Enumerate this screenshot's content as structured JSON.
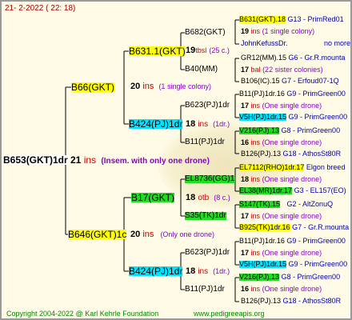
{
  "header": {
    "date": "21-  2-2022 ( 22: 18)"
  },
  "footer": {
    "copyright": "Copyright 2004-2022 @ Karl Kehrle Foundation",
    "site": "www.pedigreeapis.org"
  },
  "root": {
    "label": "B653(GKT)1dr",
    "num": "21",
    "ins": "ins",
    "note": "(Insem. with only one drone)"
  },
  "gen1": [
    {
      "label": "B66(GKT)",
      "num": "20",
      "ins": "ins",
      "note": "(1 single colony)"
    },
    {
      "label": "B646(GKT)1c",
      "num": "20",
      "ins": "ins",
      "note": "(Only one drone)"
    }
  ],
  "gen2": [
    {
      "label": "B631.1(GKT)",
      "num": "19",
      "ins": "tbsl",
      "note": "(25 c.)"
    },
    {
      "label": "B424(PJ)1dr",
      "num": "18",
      "ins": "ins",
      "note": "(1dr.)"
    },
    {
      "label": "B17(GKT)",
      "num": "18",
      "ins": "otb",
      "note": "(8 c.)"
    },
    {
      "label": "B424(PJ)1dr",
      "num": "18",
      "ins": "ins",
      "note": "(1dr.)"
    }
  ],
  "gen3": [
    {
      "label": "B682(GKT)"
    },
    {
      "label": "B40(MM)"
    },
    {
      "label": "B623(PJ)1dr"
    },
    {
      "label": "B11(PJ)1dr"
    },
    {
      "label": "EL8736(GG)1"
    },
    {
      "label": "S35(TK)1dr"
    },
    {
      "label": "B623(PJ)1dr"
    },
    {
      "label": "B11(PJ)1dr"
    }
  ],
  "gen4": [
    {
      "label": "B631(GKT).18",
      "suffix": "G13 - PrimRed01"
    },
    {
      "num": "19",
      "ins": "ins",
      "note": "(1 single colony)"
    },
    {
      "label": "JohnKefussDr.",
      "suffix": "no more"
    },
    {
      "label": "GR12(MM).15",
      "suffix": "G6 - Gr.R.mounta"
    },
    {
      "num": "17",
      "ins": "bal",
      "note": "(22 sister colonies)"
    },
    {
      "label": "B106(IC).15",
      "suffix": "G7 - Erfoud07-1Q"
    },
    {
      "label": "B11(PJ)1dr.16",
      "suffix": "G9 - PrimGreen00"
    },
    {
      "num": "17",
      "ins": "ins",
      "note": "(One single drone)"
    },
    {
      "label": "V5H(PJ)1dr.15",
      "suffix": "G9 - PrimGreen00"
    },
    {
      "label": "V216(PJ).13",
      "suffix": "G8 - PrimGreen00"
    },
    {
      "num": "16",
      "ins": "ins",
      "note": "(One single drone)"
    },
    {
      "label": "B126(PJ).13",
      "suffix": "G18 - AthosSt80R"
    },
    {
      "label": "EL7112(RHO)1dr.17",
      "suffix": "Elgon breed"
    },
    {
      "num": "18",
      "ins": "ins",
      "note": "(One single drone)"
    },
    {
      "label": "EL38(MR)1dr.17",
      "suffix": "G3 - EL157(EO)"
    },
    {
      "label": "S147(TK).15",
      "suffix": "G2 - AltZonuQ"
    },
    {
      "num": "17",
      "ins": "ins",
      "note": "(One single drone)"
    },
    {
      "label": "B925(TK)1dr.16",
      "suffix": "G7 - Gr.R.mounta"
    },
    {
      "label": "B11(PJ)1dr.16",
      "suffix": "G9 - PrimGreen00"
    },
    {
      "num": "17",
      "ins": "ins",
      "note": "(One single drone)"
    },
    {
      "label": "V5H(PJ)1dr.15",
      "suffix": "G9 - PrimGreen00"
    },
    {
      "label": "V216(PJ).13",
      "suffix": "G8 - PrimGreen00"
    },
    {
      "num": "16",
      "ins": "ins",
      "note": "(One single drone)"
    },
    {
      "label": "B126(PJ).13",
      "suffix": "G18 - AthosSt80R"
    }
  ],
  "colors": {
    "highlight_yellow": "#ffff00",
    "highlight_cyan": "#00e5ff",
    "highlight_green": "#22dd22",
    "ins_red": "#cc0000",
    "note_purple": "#8800cc",
    "suffix_blue": "#0000aa",
    "footer_green": "#008800"
  }
}
